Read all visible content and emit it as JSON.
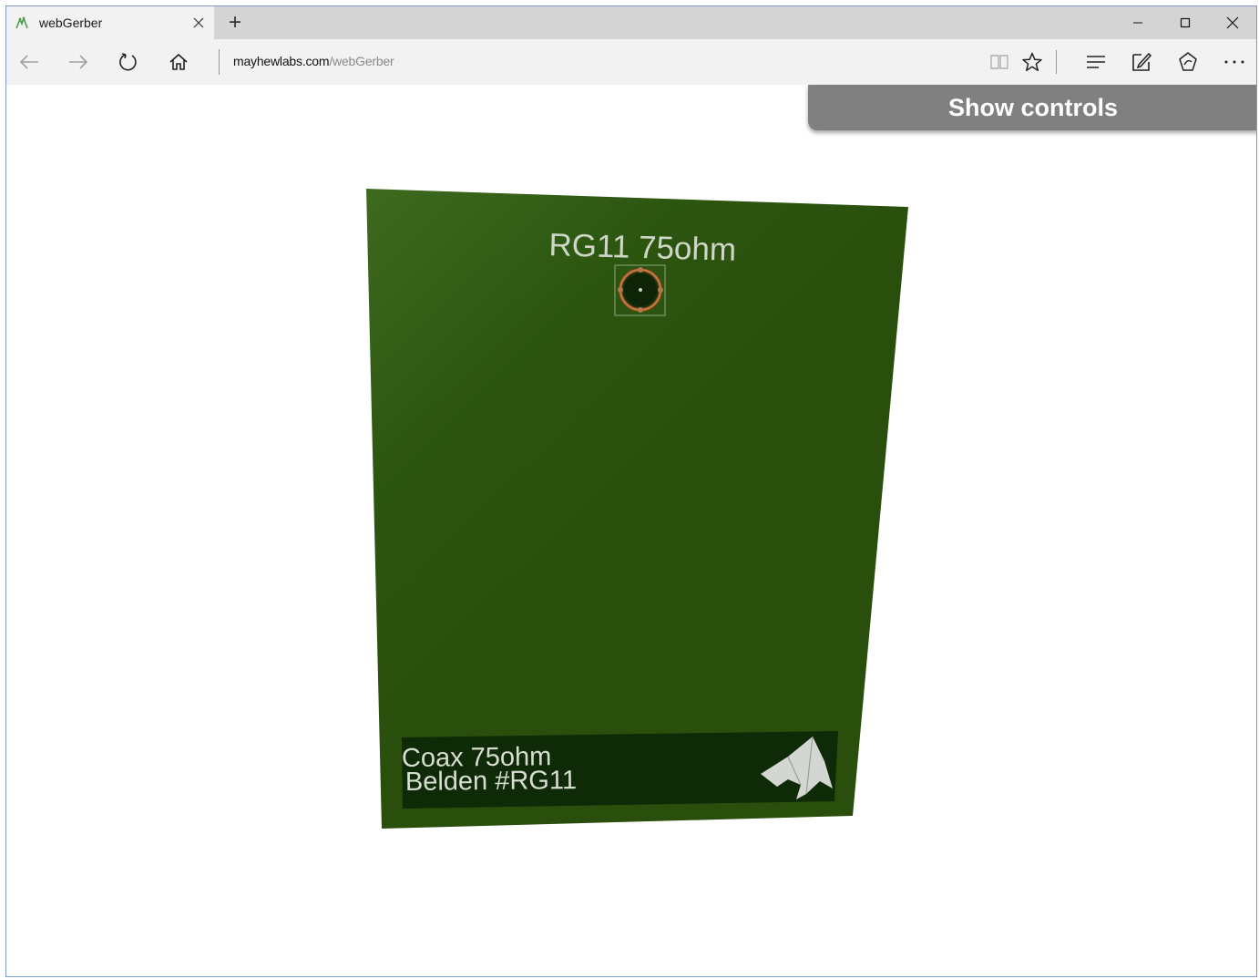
{
  "browser": {
    "tab": {
      "title": "webGerber",
      "favicon": "webgerber-icon"
    },
    "new_tab_label": "+",
    "caption": {
      "minimize": "–",
      "maximize": "☐",
      "close": "✕"
    },
    "address": {
      "host": "mayhewlabs.com",
      "path": "/webGerber"
    },
    "icons": {
      "back": "back-arrow-icon",
      "forward": "forward-arrow-icon",
      "refresh": "refresh-icon",
      "home": "home-icon",
      "reading_view": "reading-view-icon",
      "favorite": "star-icon",
      "hub": "hub-icon",
      "web_note": "web-note-icon",
      "share": "share-icon",
      "more": "more-icon"
    }
  },
  "page": {
    "show_controls_label": "Show controls",
    "board": {
      "top_label": "RG11 75ohm",
      "bottom_line1": "Coax 75ohm",
      "bottom_line2": "Belden #RG11",
      "colors": {
        "board": "#2f5a10",
        "board_highlight": "#3e6a1e",
        "label_box": "#0e2a06",
        "silkscreen": "#d6dcd0",
        "copper_ring": "#c87a3a"
      }
    }
  }
}
